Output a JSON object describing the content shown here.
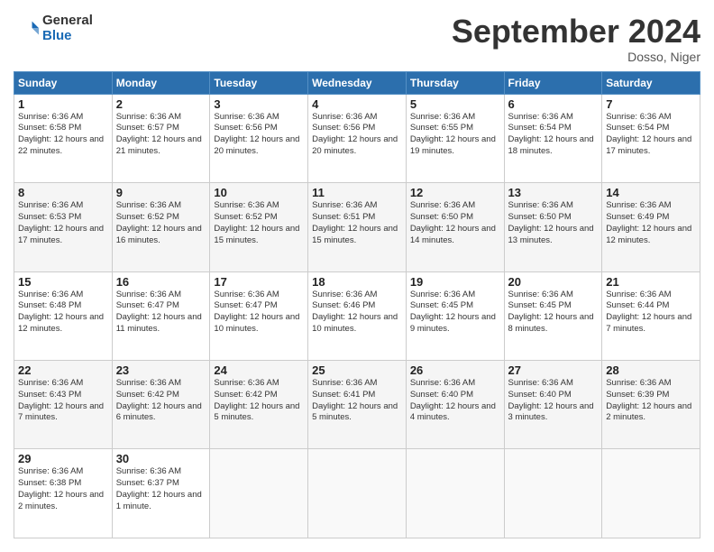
{
  "header": {
    "logo_general": "General",
    "logo_blue": "Blue",
    "title": "September 2024",
    "location": "Dosso, Niger"
  },
  "days_of_week": [
    "Sunday",
    "Monday",
    "Tuesday",
    "Wednesday",
    "Thursday",
    "Friday",
    "Saturday"
  ],
  "weeks": [
    [
      {
        "day": 1,
        "sunrise": "6:36 AM",
        "sunset": "6:58 PM",
        "daylight": "12 hours and 22 minutes."
      },
      {
        "day": 2,
        "sunrise": "6:36 AM",
        "sunset": "6:57 PM",
        "daylight": "12 hours and 21 minutes."
      },
      {
        "day": 3,
        "sunrise": "6:36 AM",
        "sunset": "6:56 PM",
        "daylight": "12 hours and 20 minutes."
      },
      {
        "day": 4,
        "sunrise": "6:36 AM",
        "sunset": "6:56 PM",
        "daylight": "12 hours and 20 minutes."
      },
      {
        "day": 5,
        "sunrise": "6:36 AM",
        "sunset": "6:55 PM",
        "daylight": "12 hours and 19 minutes."
      },
      {
        "day": 6,
        "sunrise": "6:36 AM",
        "sunset": "6:54 PM",
        "daylight": "12 hours and 18 minutes."
      },
      {
        "day": 7,
        "sunrise": "6:36 AM",
        "sunset": "6:54 PM",
        "daylight": "12 hours and 17 minutes."
      }
    ],
    [
      {
        "day": 8,
        "sunrise": "6:36 AM",
        "sunset": "6:53 PM",
        "daylight": "12 hours and 17 minutes."
      },
      {
        "day": 9,
        "sunrise": "6:36 AM",
        "sunset": "6:52 PM",
        "daylight": "12 hours and 16 minutes."
      },
      {
        "day": 10,
        "sunrise": "6:36 AM",
        "sunset": "6:52 PM",
        "daylight": "12 hours and 15 minutes."
      },
      {
        "day": 11,
        "sunrise": "6:36 AM",
        "sunset": "6:51 PM",
        "daylight": "12 hours and 15 minutes."
      },
      {
        "day": 12,
        "sunrise": "6:36 AM",
        "sunset": "6:50 PM",
        "daylight": "12 hours and 14 minutes."
      },
      {
        "day": 13,
        "sunrise": "6:36 AM",
        "sunset": "6:50 PM",
        "daylight": "12 hours and 13 minutes."
      },
      {
        "day": 14,
        "sunrise": "6:36 AM",
        "sunset": "6:49 PM",
        "daylight": "12 hours and 12 minutes."
      }
    ],
    [
      {
        "day": 15,
        "sunrise": "6:36 AM",
        "sunset": "6:48 PM",
        "daylight": "12 hours and 12 minutes."
      },
      {
        "day": 16,
        "sunrise": "6:36 AM",
        "sunset": "6:47 PM",
        "daylight": "12 hours and 11 minutes."
      },
      {
        "day": 17,
        "sunrise": "6:36 AM",
        "sunset": "6:47 PM",
        "daylight": "12 hours and 10 minutes."
      },
      {
        "day": 18,
        "sunrise": "6:36 AM",
        "sunset": "6:46 PM",
        "daylight": "12 hours and 10 minutes."
      },
      {
        "day": 19,
        "sunrise": "6:36 AM",
        "sunset": "6:45 PM",
        "daylight": "12 hours and 9 minutes."
      },
      {
        "day": 20,
        "sunrise": "6:36 AM",
        "sunset": "6:45 PM",
        "daylight": "12 hours and 8 minutes."
      },
      {
        "day": 21,
        "sunrise": "6:36 AM",
        "sunset": "6:44 PM",
        "daylight": "12 hours and 7 minutes."
      }
    ],
    [
      {
        "day": 22,
        "sunrise": "6:36 AM",
        "sunset": "6:43 PM",
        "daylight": "12 hours and 7 minutes."
      },
      {
        "day": 23,
        "sunrise": "6:36 AM",
        "sunset": "6:42 PM",
        "daylight": "12 hours and 6 minutes."
      },
      {
        "day": 24,
        "sunrise": "6:36 AM",
        "sunset": "6:42 PM",
        "daylight": "12 hours and 5 minutes."
      },
      {
        "day": 25,
        "sunrise": "6:36 AM",
        "sunset": "6:41 PM",
        "daylight": "12 hours and 5 minutes."
      },
      {
        "day": 26,
        "sunrise": "6:36 AM",
        "sunset": "6:40 PM",
        "daylight": "12 hours and 4 minutes."
      },
      {
        "day": 27,
        "sunrise": "6:36 AM",
        "sunset": "6:40 PM",
        "daylight": "12 hours and 3 minutes."
      },
      {
        "day": 28,
        "sunrise": "6:36 AM",
        "sunset": "6:39 PM",
        "daylight": "12 hours and 2 minutes."
      }
    ],
    [
      {
        "day": 29,
        "sunrise": "6:36 AM",
        "sunset": "6:38 PM",
        "daylight": "12 hours and 2 minutes."
      },
      {
        "day": 30,
        "sunrise": "6:36 AM",
        "sunset": "6:37 PM",
        "daylight": "12 hours and 1 minute."
      },
      null,
      null,
      null,
      null,
      null
    ]
  ],
  "labels": {
    "sunrise": "Sunrise:",
    "sunset": "Sunset:",
    "daylight": "Daylight:"
  }
}
